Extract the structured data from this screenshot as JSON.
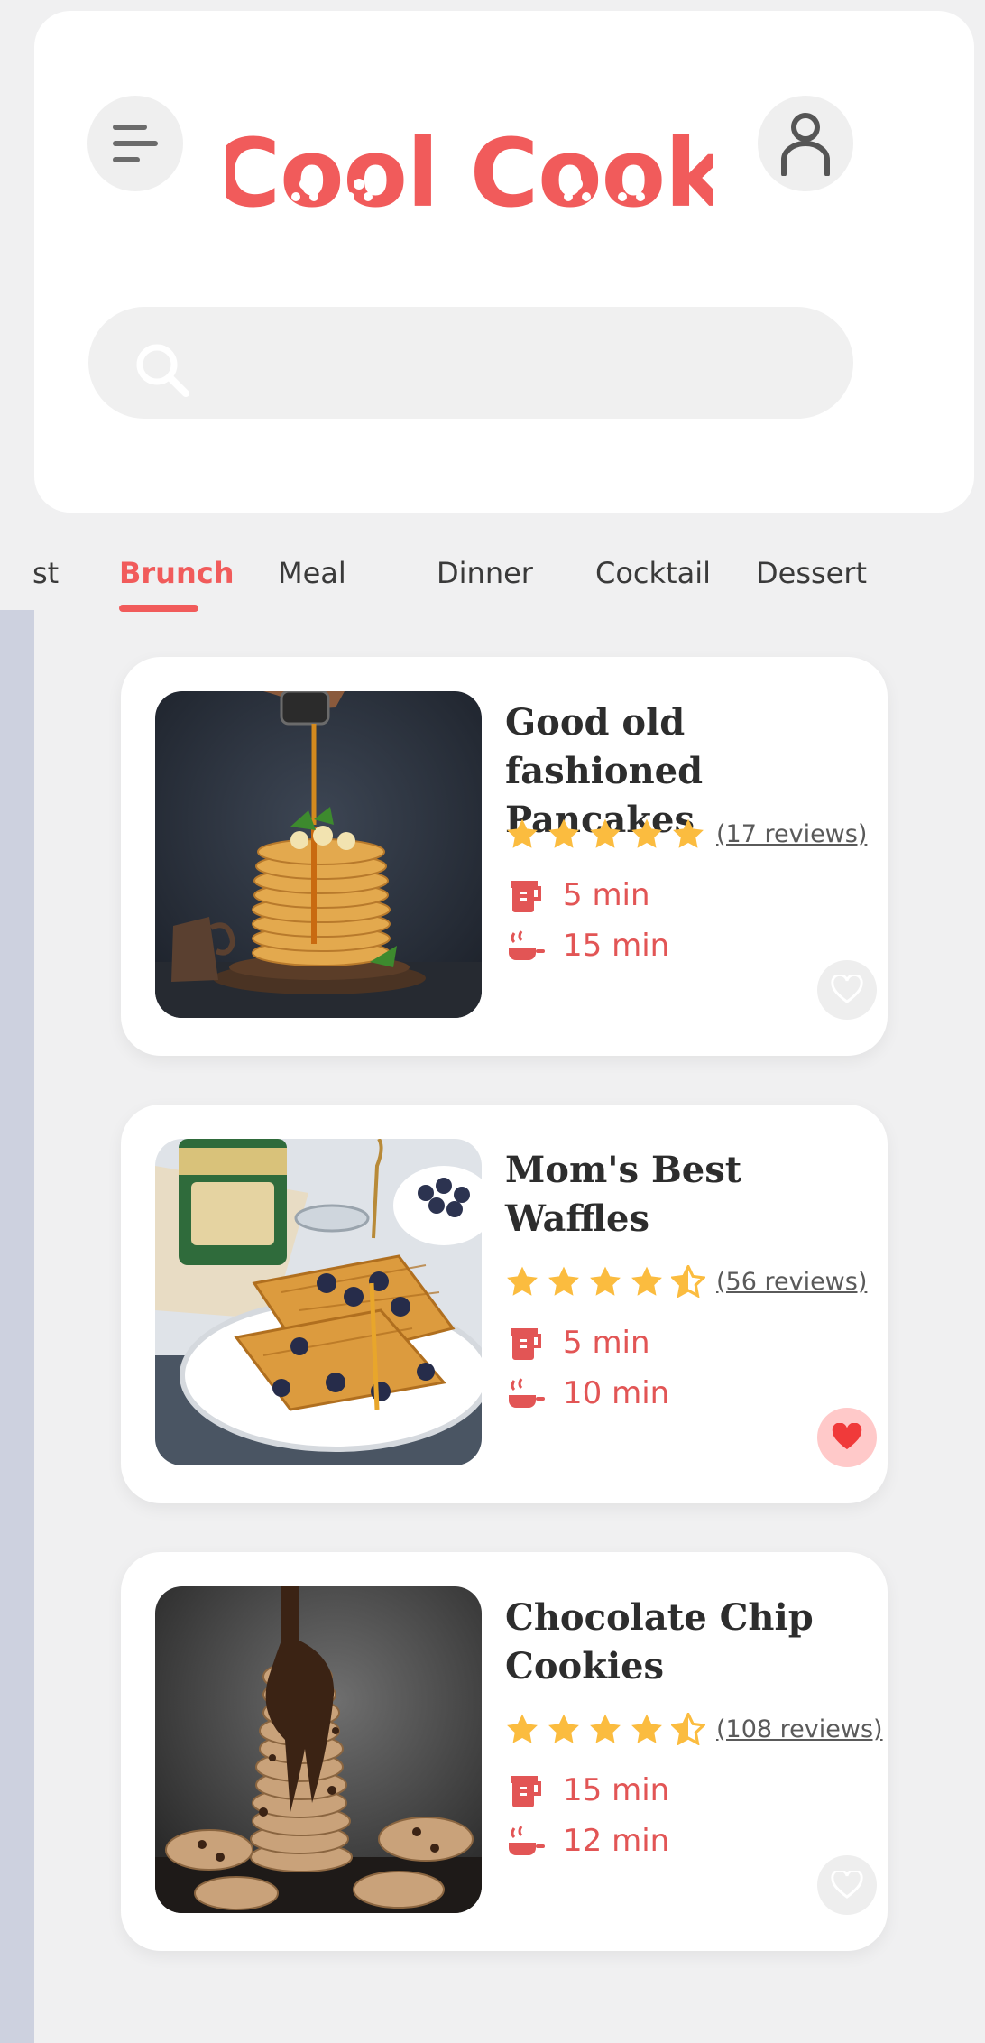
{
  "app": {
    "title": "Cool Cook",
    "accent_color": "#f15b5b",
    "star_color": "#fbbc3f"
  },
  "header": {
    "menu_icon": "hamburger-icon",
    "profile_icon": "user-icon",
    "logo_text": "Cool Cook"
  },
  "search": {
    "placeholder": "",
    "value": "",
    "icon": "search-icon"
  },
  "tabs": [
    {
      "label": "st",
      "active": false
    },
    {
      "label": "Brunch",
      "active": true
    },
    {
      "label": "Meal",
      "active": false
    },
    {
      "label": "Dinner",
      "active": false
    },
    {
      "label": "Cocktail",
      "active": false
    },
    {
      "label": "Dessert",
      "active": false
    }
  ],
  "recipes": [
    {
      "title_line1": "Good old fashioned",
      "title_line2": "Pancakes",
      "rating": 5,
      "reviews": "(17 reviews)",
      "prep_time": "5 min",
      "cook_time": "15 min",
      "favorite": false,
      "image": "pancakes-photo"
    },
    {
      "title_line1": "Mom's Best",
      "title_line2": "Waffles",
      "rating": 4.5,
      "reviews": "(56 reviews)",
      "prep_time": "5 min",
      "cook_time": "10 min",
      "favorite": true,
      "image": "waffles-photo"
    },
    {
      "title_line1": "Chocolate Chip",
      "title_line2": "Cookies",
      "rating": 4.5,
      "reviews": "(108 reviews)",
      "prep_time": "15 min",
      "cook_time": "12 min",
      "favorite": false,
      "image": "cookies-photo"
    }
  ]
}
